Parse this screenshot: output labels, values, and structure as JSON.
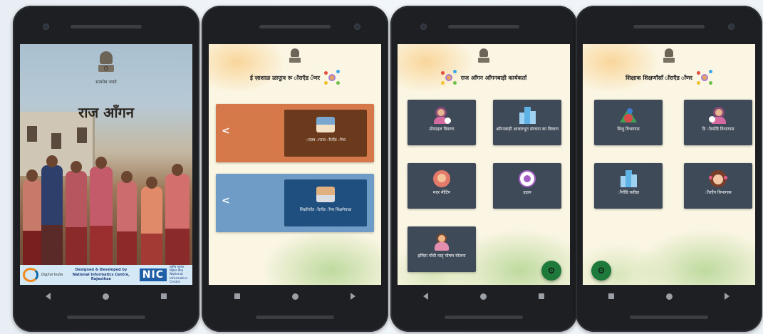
{
  "screen1": {
    "motto": "सत्यमेव जयते",
    "title": "राज आँगन",
    "footer": {
      "digital_india": "Digital India",
      "designed_by": "Designed & Developed by",
      "nic_full": "National Informatics Centre, Rajasthan",
      "nic_logo": "NIC",
      "nic_hindi": "राष्ट्रीय सूचना विज्ञान केन्द्र",
      "nic_english": "National Informatics Centre"
    }
  },
  "screen2": {
    "header": "ई ज़ाशाळ ळाएूाव रू ाँराएँड ँणर",
    "cards": [
      {
        "label": "ाज़ाष ाजाव ाँराएँड ाँणर",
        "color": "#d5784a",
        "inner": "#6b3a1c"
      },
      {
        "label": "शिक्षाँराएँड ाँराएँड ाँणर शिक्षणेचाळ",
        "color": "#6f9cc7",
        "inner": "#1f4f7e"
      }
    ]
  },
  "screen3": {
    "header": "राज आँगन आँगनबाड़ी कार्यकर्ता",
    "tiles": [
      {
        "label": "प्रोफाइल विवरण"
      },
      {
        "label": "आँगनवाड़ी आधारभूत संरचना का विवरण"
      },
      {
        "label": "मदर मीटिंग"
      },
      {
        "label": "उड़ान"
      },
      {
        "label": "इन्दिरा गाँधी मातृ पोषण योजना"
      }
    ],
    "fab_icon": "gear-icon"
  },
  "screen4": {
    "header": "शिक्षाक शिक्षणाँसाँ ाँराएँड ाँणर",
    "tiles": [
      {
        "label": "शिशु विभागास"
      },
      {
        "label": "डि ाँस्पोडि विभागास"
      },
      {
        "label": "ाँगोंडि करीडा"
      },
      {
        "label": "ाँराएँग विभागास"
      }
    ],
    "fab_icon": "gear-icon"
  }
}
